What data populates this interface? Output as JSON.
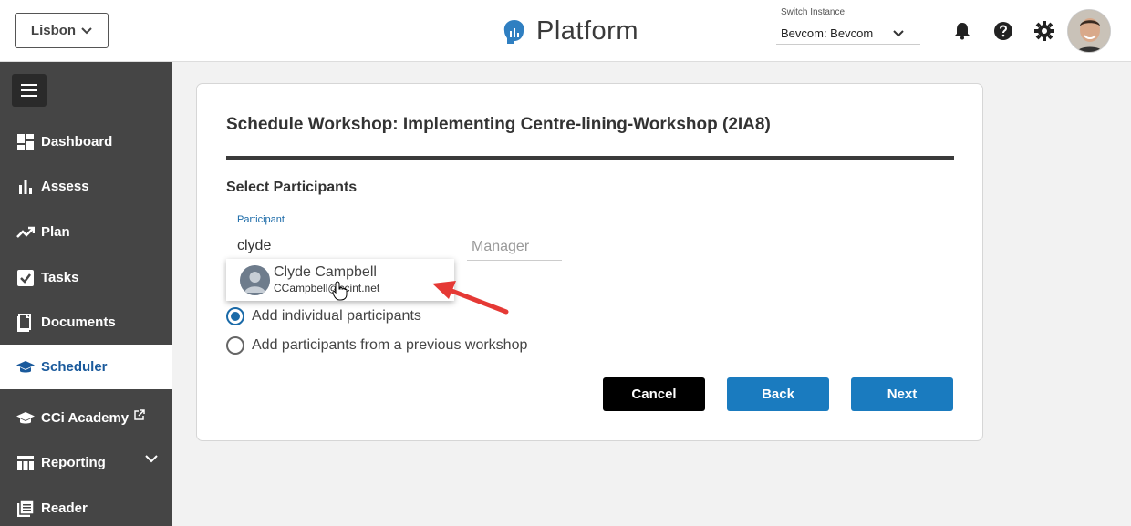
{
  "header": {
    "location_label": "Lisbon",
    "app_title": "Platform",
    "switch_instance": {
      "label": "Switch Instance",
      "value": "Bevcom: Bevcom"
    }
  },
  "sidebar": {
    "items": [
      {
        "label": "Dashboard",
        "icon": "dashboard-icon"
      },
      {
        "label": "Assess",
        "icon": "bar-chart-icon"
      },
      {
        "label": "Plan",
        "icon": "trend-up-icon"
      },
      {
        "label": "Tasks",
        "icon": "checkbox-icon"
      },
      {
        "label": "Documents",
        "icon": "documents-icon"
      },
      {
        "label": "Scheduler",
        "icon": "graduation-cap-icon",
        "active": true
      },
      {
        "label": "CCi Academy",
        "icon": "graduation-cap-icon",
        "external": true
      },
      {
        "label": "Reporting",
        "icon": "table-icon",
        "expandable": true
      },
      {
        "label": "Reader",
        "icon": "reader-icon"
      }
    ]
  },
  "workshop": {
    "title": "Schedule Workshop: Implementing Centre-lining-Workshop (2IA8)",
    "section_title": "Select Participants",
    "participant_label": "Participant",
    "participant_value": "clyde",
    "manager_placeholder": "Manager",
    "suggestion": {
      "name": "Clyde Campbell",
      "email": "CCampbell@ccint.net"
    },
    "options": [
      {
        "label": "Add individual participants",
        "selected": true
      },
      {
        "label": "Add participants from a previous workshop",
        "selected": false
      }
    ],
    "buttons": {
      "cancel": "Cancel",
      "back": "Back",
      "next": "Next"
    }
  },
  "colors": {
    "accent": "#1a7bbf",
    "sidebar_bg": "#454545",
    "arrow": "#e53935"
  }
}
